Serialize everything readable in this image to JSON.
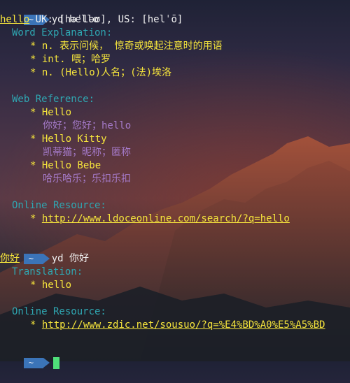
{
  "prompt_symbol": "~",
  "session1": {
    "command": "yd hello",
    "word": "hello",
    "phonetic": " UK: [həˈləʊ], US: [helˈō]",
    "word_explanation_header": "Word Explanation:",
    "definitions": [
      "n. 表示问候， 惊奇或唤起注意时的用语",
      "int. 喂；哈罗",
      "n. (Hello)人名；(法)埃洛"
    ],
    "web_reference_header": "Web Reference:",
    "web_refs": [
      {
        "phrase": "Hello",
        "meaning": "你好；您好；hello"
      },
      {
        "phrase": "Hello Kitty",
        "meaning": "凯蒂猫；昵称；匿称"
      },
      {
        "phrase": "Hello Bebe",
        "meaning": "哈乐哈乐；乐扣乐扣"
      }
    ],
    "online_resource_header": "Online Resource:",
    "online_url": "http://www.ldoceonline.com/search/?q=hello"
  },
  "session2": {
    "command": "yd 你好",
    "word": "你好",
    "translation_header": "Translation:",
    "translation": "hello",
    "online_resource_header": "Online Resource:",
    "online_url": "http://www.zdic.net/sousuo/?q=%E4%BD%A0%E5%A5%BD"
  },
  "colors": {
    "prompt_bg": "#3b74b8",
    "headword": "#f6e53c",
    "section": "#2fa7b2",
    "meaning": "#a57ac9",
    "cursor": "#4fe07a"
  }
}
